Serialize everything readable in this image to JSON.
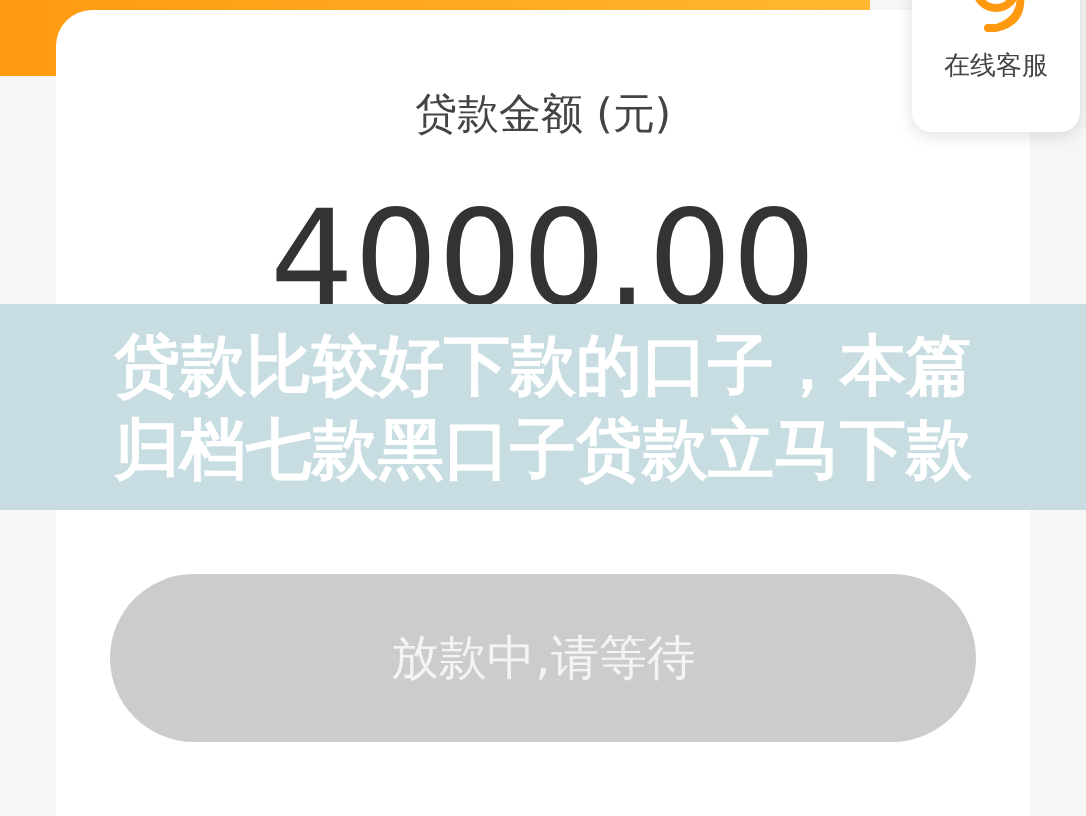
{
  "service_widget": {
    "label": "在线客服"
  },
  "loan": {
    "amount_label": "贷款金额 (元)",
    "amount": "4000.00"
  },
  "action_button": {
    "label": "放款中,请等待",
    "disabled": true
  },
  "banner": {
    "lines": [
      "贷款比较好下款的口子，本篇",
      "归档七款黑口子贷款立马下款"
    ]
  }
}
